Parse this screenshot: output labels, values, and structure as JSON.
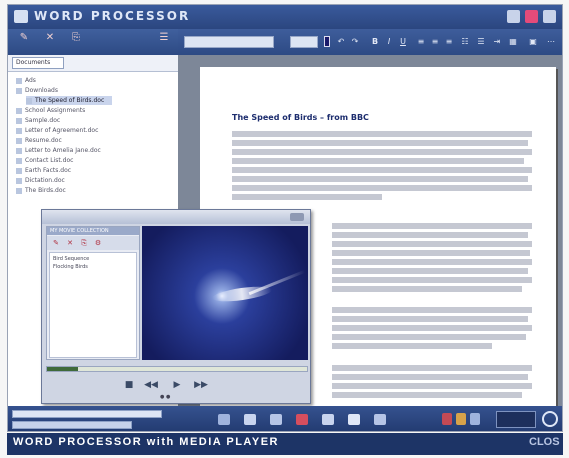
{
  "window": {
    "title": "WORD PROCESSOR"
  },
  "sidebar": {
    "tab_label": "Documents",
    "tree": [
      "Ads",
      "Downloads",
      "The Speed of Birds.doc",
      "School Assignments",
      "Sample.doc",
      "Letter of Agreement.doc",
      "Resume.doc",
      "Letter to Amelia Jane.doc",
      "Contact List.doc",
      "Earth Facts.doc",
      "Dictation.doc",
      "The Birds.doc"
    ]
  },
  "document": {
    "title": "The Speed of Birds – from BBC"
  },
  "player": {
    "library_header": "MY MOVIE COLLECTION",
    "items": [
      "Bird Sequence",
      "Flocking Birds"
    ],
    "progress": 0.12
  },
  "caption": {
    "text": "WORD PROCESSOR with MEDIA PLAYER",
    "right": "CLOS"
  },
  "colors": {
    "accent": "#2b467f",
    "page": "#ffffff",
    "caption_bg": "#1d3466"
  },
  "icons": [
    "app-logo-icon",
    "minimize-icon",
    "restore-icon",
    "close-icon",
    "play-icon",
    "stop-icon",
    "rewind-icon",
    "forward-icon",
    "power-icon"
  ]
}
